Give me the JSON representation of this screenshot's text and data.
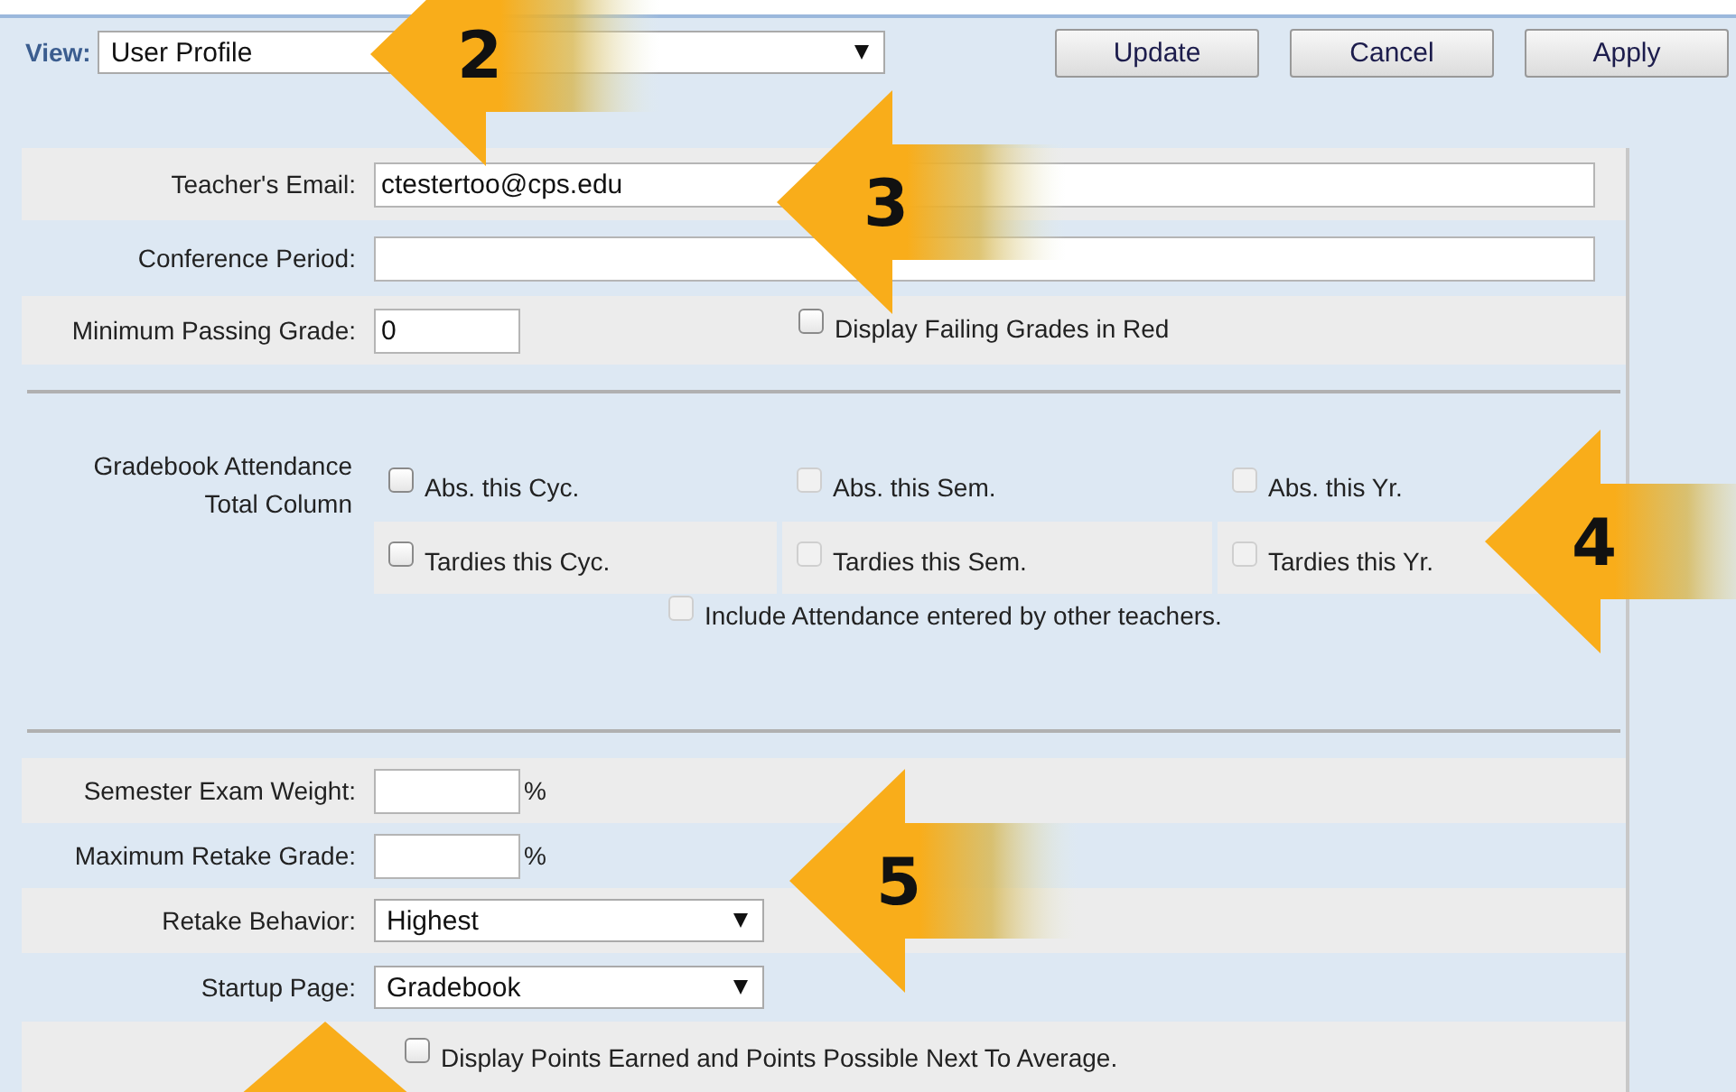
{
  "view": {
    "label": "View:",
    "value": "User Profile"
  },
  "buttons": [
    "Update",
    "Cancel",
    "Apply"
  ],
  "profile_fields": [
    {
      "label": "Teacher's Email:",
      "value": "ctestertoo@cps.edu"
    },
    {
      "label": "Conference Period:"
    }
  ],
  "minimum_passing_grade": {
    "label": "Minimum Passing Grade:",
    "value": "0"
  },
  "failing_in_red": {
    "label": "Display Failing Grades in Red",
    "checked": false,
    "disabled": false
  },
  "attendance": {
    "label": "Gradebook Attendance Total Column",
    "options": [
      {
        "label": "Abs. this Cyc.",
        "checked": false,
        "disabled": false
      },
      {
        "label": "Abs. this Sem.",
        "checked": false,
        "disabled": true
      },
      {
        "label": "Abs. this Yr.",
        "checked": false,
        "disabled": true
      },
      {
        "label": "Tardies this Cyc.",
        "checked": false,
        "disabled": false
      },
      {
        "label": "Tardies this Sem.",
        "checked": false,
        "disabled": true
      },
      {
        "label": "Tardies this Yr.",
        "checked": false,
        "disabled": true
      }
    ],
    "include_others": {
      "label": "Include Attendance entered by other teachers.",
      "checked": false,
      "disabled": true
    }
  },
  "grading_fields": [
    {
      "label": "Semester Exam Weight:",
      "kind": "percent",
      "unit": "%"
    },
    {
      "label": "Maximum Retake Grade:",
      "kind": "percent",
      "unit": "%"
    },
    {
      "label": "Retake Behavior:",
      "kind": "select",
      "value": "Highest"
    },
    {
      "label": "Startup Page:",
      "kind": "select",
      "value": "Gradebook"
    }
  ],
  "display_points": {
    "label": "Display Points Earned and Points Possible Next To Average.",
    "checked": false,
    "disabled": false
  },
  "callouts": [
    {
      "label": "2",
      "kind": "left_arrow"
    },
    {
      "label": "3",
      "kind": "left_arrow"
    },
    {
      "label": "4",
      "kind": "left_arrow"
    },
    {
      "label": "5",
      "kind": "left_arrow"
    },
    {
      "kind": "up_arrow"
    }
  ]
}
